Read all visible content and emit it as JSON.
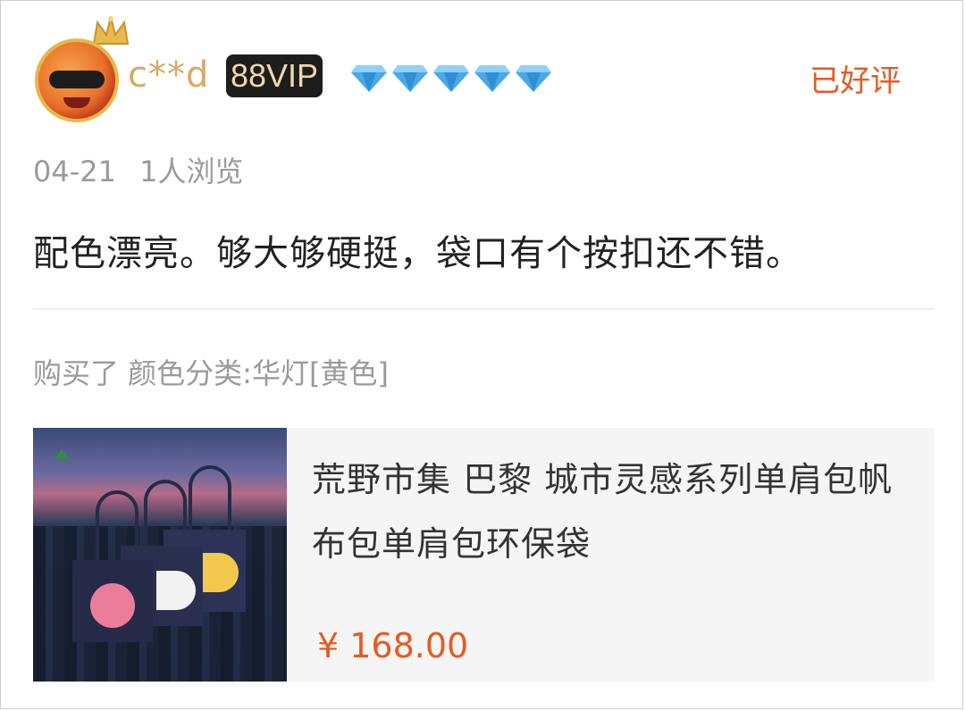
{
  "review": {
    "user": {
      "avatar_icon": "avatar-icon",
      "name": "c**d",
      "vip_badge": "88VIP",
      "level_diamonds": 5
    },
    "status": "已好评",
    "date": "04-21",
    "views": "1人浏览",
    "content": "配色漂亮。够大够硬挺，袋口有个按扣还不错。",
    "purchase_info": "购买了 颜色分类:华灯[黄色]",
    "product": {
      "title": "荒野市集 巴黎 城市灵感系列单肩包帆布包单肩包环保袋",
      "price": "¥ 168.00"
    }
  },
  "colors": {
    "accent": "#e55b21",
    "username": "#d9a865",
    "meta_text": "#9a9a9a",
    "vip_bg": "#1d1d1d",
    "vip_text": "#f4d6a8",
    "diamond": "#4aa8e8"
  }
}
